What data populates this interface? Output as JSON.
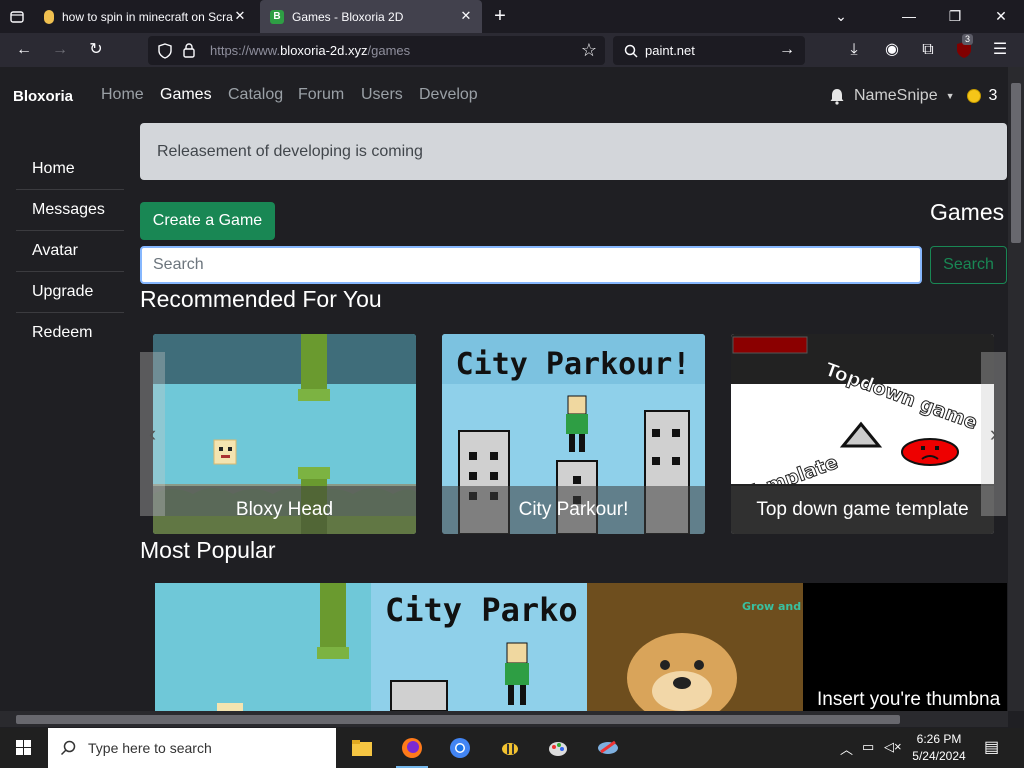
{
  "browser": {
    "tabs": [
      {
        "title": "how to spin in minecraft on Scra",
        "active": false
      },
      {
        "title": "Games - Bloxoria 2D",
        "active": true
      }
    ],
    "new_tab": "+",
    "url": {
      "prefix": "https://www.",
      "host": "bloxoria-2d.xyz",
      "path": "/games"
    },
    "search_text": "paint.net",
    "extension_badge": "3"
  },
  "site": {
    "brand": "Bloxoria",
    "nav": [
      "Home",
      "Games",
      "Catalog",
      "Forum",
      "Users",
      "Develop"
    ],
    "active_nav": "Games",
    "username": "NameSnipe",
    "coins": "3",
    "sidebar": [
      "Home",
      "Messages",
      "Avatar",
      "Upgrade",
      "Redeem"
    ],
    "announcement": "Releasement of developing is coming",
    "create_button": "Create a Game",
    "page_title": "Games",
    "search": {
      "placeholder": "Search",
      "value": "",
      "button": "Search"
    },
    "recommended_title": "Recommended For You",
    "recommended": [
      {
        "title": "Bloxy Head"
      },
      {
        "title": "City Parkour!",
        "art_text": "City Parkour!"
      },
      {
        "title": "Top down game template",
        "art_text_1": "Topdown game",
        "art_text_2": "Template"
      }
    ],
    "popular_title": "Most Popular",
    "popular": [
      {
        "art_text": ""
      },
      {
        "art_text": "City Parko"
      },
      {
        "art_text": "Grow and EP Dog"
      },
      {
        "art_text": "Insert you're thumbna"
      }
    ]
  },
  "taskbar": {
    "search_placeholder": "Type here to search",
    "time": "6:26 PM",
    "date": "5/24/2024"
  },
  "colors": {
    "accent_green": "#198754",
    "focus_blue": "#86b7fe",
    "site_bg": "#1f1f23"
  }
}
